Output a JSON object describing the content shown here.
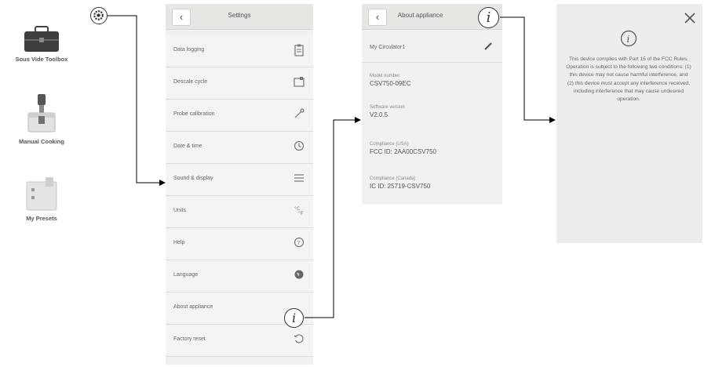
{
  "home": {
    "items": [
      {
        "label": "Sous Vide Toolbox"
      },
      {
        "label": "Manual Cooking"
      },
      {
        "label": "My Presets"
      }
    ]
  },
  "settings": {
    "title": "Settings",
    "items": [
      {
        "label": "Data logging",
        "icon": "clipboard-icon"
      },
      {
        "label": "Descale cycle",
        "icon": "descale-icon"
      },
      {
        "label": "Probe calibration",
        "icon": "probe-icon"
      },
      {
        "label": "Date & time",
        "icon": "clock-icon"
      },
      {
        "label": "Sound & display",
        "icon": "menu-lines-icon"
      },
      {
        "label": "Units",
        "icon": "units-icon"
      },
      {
        "label": "Help",
        "icon": "help-icon"
      },
      {
        "label": "Language",
        "icon": "globe-icon"
      },
      {
        "label": "About appliance",
        "icon": "info-icon"
      },
      {
        "label": "Factory reset",
        "icon": "reset-icon"
      }
    ]
  },
  "about": {
    "title": "About appliance",
    "device_name": "My Circulator1",
    "model_label": "Model number",
    "model_value": "CSV750-09EC",
    "software_label": "Software version",
    "software_value": "V2.0.5",
    "compliance_usa_label": "Compliance (USA)",
    "compliance_usa_value": "FCC ID: 2AA00CSV750",
    "compliance_canada_label": "Compliance (Canada)",
    "compliance_canada_value": "IC ID: 25719-CSV750"
  },
  "notice": {
    "text": "This device complies with Part 15 of the FCC Rules. Operation is subject to the following two conditions: (1) this device may not cause harmful interference, and (2) this device must accept any interference received, including interference that may cause undesired operation."
  },
  "colors": {
    "panel": "#f1f1ef",
    "header": "#e6e6e3",
    "arrow": "#000000"
  }
}
